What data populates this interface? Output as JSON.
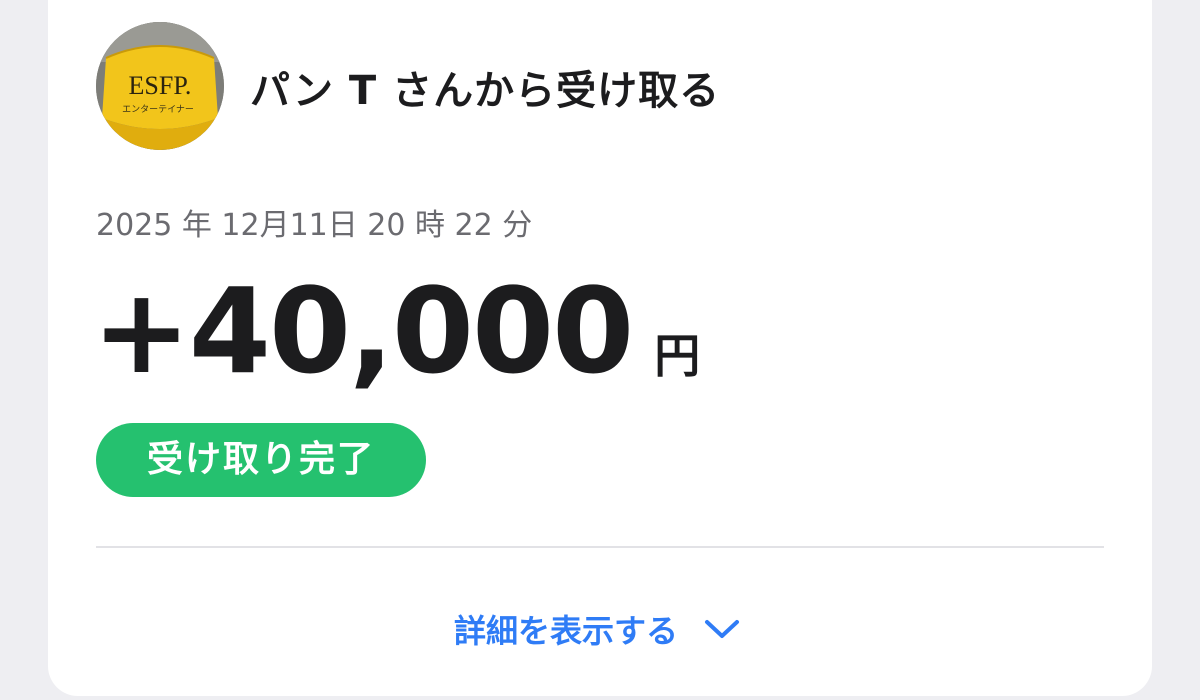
{
  "transaction": {
    "title": "パン T さんから受け取る",
    "datetime": "2025 年 12月11日 20 時 22 分",
    "amount": "+40,000",
    "currency": "円",
    "status": "受け取り完了",
    "details_label": "詳細を表示する"
  },
  "avatar": {
    "alt": "ESFP yellow cap photo",
    "cap_text": "ESFP.",
    "cap_subtext": "エンターテイナー"
  },
  "icons": {
    "details_chevron": "chevron-down-icon"
  },
  "colors": {
    "status_green": "#25c16f",
    "link_blue": "#2f7cf6",
    "text_primary": "#1c1c1e",
    "text_secondary": "#6b6b70",
    "page_bg": "#eeeef2"
  }
}
